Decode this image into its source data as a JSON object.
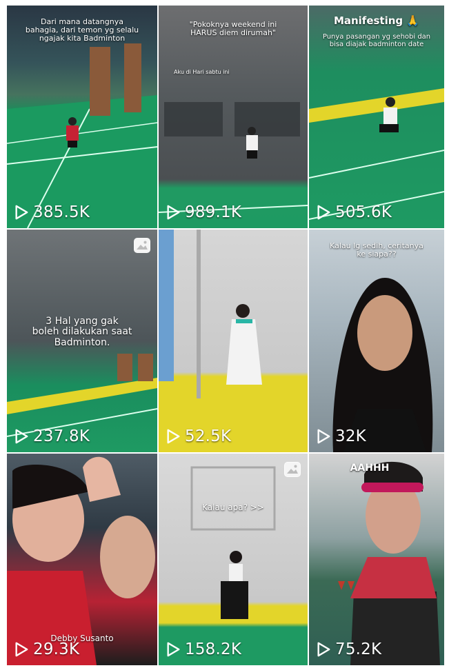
{
  "tiles": [
    {
      "views": "385.5K",
      "overlay": [
        "Dari mana datangnya",
        "bahagia, dari temon yg selalu",
        "ngajak kita Badminton"
      ]
    },
    {
      "views": "989.1K",
      "overlay": [
        "\"Pokoknya weekend ini",
        "HARUS diem dirumah\""
      ],
      "sub_caption": "Aku di Hari sabtu ini"
    },
    {
      "views": "505.6K",
      "title": "Manifesting 🙏",
      "overlay": [
        "Punya pasangan yg sehobi dan",
        "bisa diajak badminton date"
      ]
    },
    {
      "views": "237.8K",
      "overlay": [
        "3 Hal yang gak",
        "boleh dilakukan saat",
        "Badminton."
      ]
    },
    {
      "views": "52.5K",
      "overlay": []
    },
    {
      "views": "32K",
      "overlay": [
        "Kalau lg sedih, ceritanya",
        "ke siapa??"
      ]
    },
    {
      "views": "29.3K",
      "overlay": [
        "Debby Susanto"
      ]
    },
    {
      "views": "158.2K",
      "overlay": [
        "Kalau apa? >>"
      ]
    },
    {
      "views": "75.2K",
      "overlay": [
        "AAHHH"
      ]
    }
  ],
  "colors": {
    "view_text": "#ffffff",
    "court_green": "#1f9e63",
    "court_yellow": "#e3d52a"
  },
  "icons": {
    "views": "play-icon",
    "photo_post": "photo-icon"
  }
}
